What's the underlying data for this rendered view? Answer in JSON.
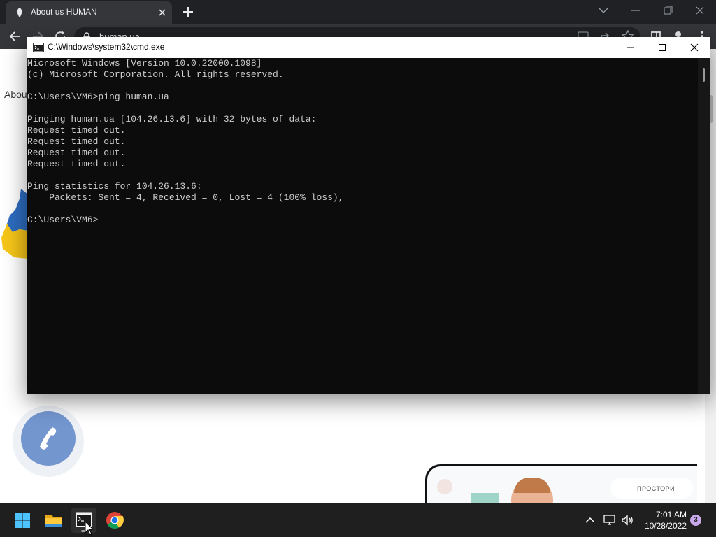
{
  "browser": {
    "tab_title": "About us HUMAN",
    "url": "human.ua"
  },
  "page": {
    "heading_fragment": "Abou",
    "promo_label": "ПРОСТОРИ"
  },
  "cmd": {
    "title": "C:\\Windows\\system32\\cmd.exe",
    "output_lines": [
      "Microsoft Windows [Version 10.0.22000.1098]",
      "(c) Microsoft Corporation. All rights reserved.",
      "",
      "C:\\Users\\VM6>ping human.ua",
      "",
      "Pinging human.ua [104.26.13.6] with 32 bytes of data:",
      "Request timed out.",
      "Request timed out.",
      "Request timed out.",
      "Request timed out.",
      "",
      "Ping statistics for 104.26.13.6:",
      "    Packets: Sent = 4, Received = 0, Lost = 4 (100% loss),",
      "",
      "C:\\Users\\VM6>"
    ]
  },
  "taskbar": {
    "apps": [
      "start-icon",
      "file-explorer-icon",
      "terminal-icon",
      "chrome-icon"
    ],
    "active_app": "terminal-icon",
    "time": "7:01 AM",
    "date": "10/28/2022",
    "notification_count": "3"
  },
  "colors": {
    "console_bg": "#0c0c0c",
    "console_text": "#cccccc",
    "chrome_dark": "#202124",
    "taskbar_bg": "#1f1f1f",
    "phone_button": "#7396cf"
  }
}
